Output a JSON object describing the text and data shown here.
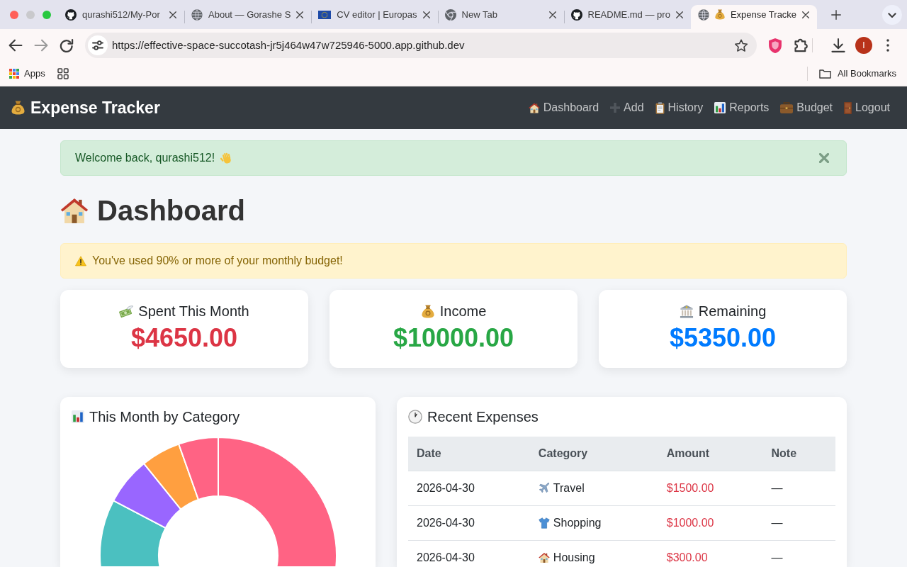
{
  "browser": {
    "tabs": [
      {
        "title": "qurashi512/My-Por",
        "selected": false
      },
      {
        "title": "About — Gorashe S",
        "selected": false
      },
      {
        "title": "CV editor | Europas",
        "selected": false
      },
      {
        "title": "New Tab",
        "selected": false
      },
      {
        "title": "README.md — pro",
        "selected": false
      },
      {
        "title": "Expense Tracke",
        "selected": true
      }
    ],
    "url": "https://effective-space-succotash-jr5j464w47w725946-5000.app.github.dev",
    "profile_initial": "I",
    "apps_label": "Apps",
    "all_bookmarks": "All Bookmarks"
  },
  "navbar": {
    "brand": "Expense Tracker",
    "links": [
      "Dashboard",
      "Add",
      "History",
      "Reports",
      "Budget",
      "Logout"
    ]
  },
  "flash": {
    "kind": "success",
    "text": "Welcome back, qurashi512!",
    "dismissible": true
  },
  "page_title": "Dashboard",
  "budget_alert": {
    "kind": "warning",
    "text": "You've used 90% or more of your monthly budget!",
    "dismissible": false
  },
  "stats": [
    {
      "label": "Spent This Month",
      "value": "$4650.00",
      "color": "#dc3545"
    },
    {
      "label": "Income",
      "value": "$10000.00",
      "color": "#28a745"
    },
    {
      "label": "Remaining",
      "value": "$5350.00",
      "color": "#007bff"
    }
  ],
  "category_chart": {
    "title": "This Month by Category"
  },
  "recent_expenses": {
    "title": "Recent Expenses",
    "columns": [
      "Date",
      "Category",
      "Amount",
      "Note"
    ],
    "rows": [
      {
        "date": "2026-04-30",
        "category": "Travel",
        "amount": "$1500.00",
        "note": "—"
      },
      {
        "date": "2026-04-30",
        "category": "Shopping",
        "amount": "$1000.00",
        "note": "—"
      },
      {
        "date": "2026-04-30",
        "category": "Housing",
        "amount": "$300.00",
        "note": "—"
      }
    ]
  }
}
